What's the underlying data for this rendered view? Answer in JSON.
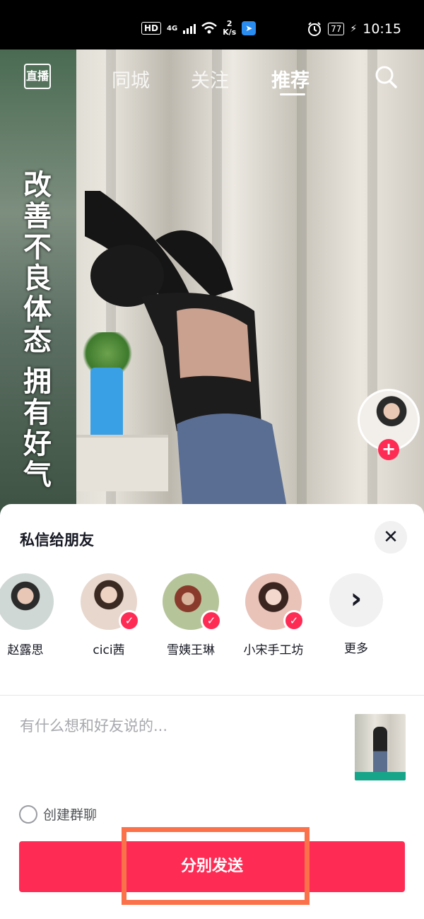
{
  "status_bar": {
    "hd_label": "HD",
    "network_label": "4G",
    "speed_value": "2",
    "speed_unit": "K/s",
    "battery": "77",
    "time": "10:15"
  },
  "top_nav": {
    "live_label": "直播",
    "tabs": [
      {
        "label": "同城",
        "active": false
      },
      {
        "label": "关注",
        "active": false
      },
      {
        "label": "推荐",
        "active": true
      }
    ]
  },
  "video": {
    "overlay_text": [
      "改",
      "善",
      "不",
      "良",
      "体",
      "态",
      "拥",
      "有",
      "好",
      "气"
    ]
  },
  "share_sheet": {
    "title": "私信给朋友",
    "friends": [
      {
        "name": "赵露思",
        "selected": false,
        "avatar_color": "#cfd8d4"
      },
      {
        "name": "cici茜",
        "selected": true,
        "avatar_color": "#e8d7cd"
      },
      {
        "name": "雪姨王琳",
        "selected": true,
        "avatar_color": "#b6c49a"
      },
      {
        "name": "小宋手工坊",
        "selected": true,
        "avatar_color": "#e9c2b8"
      }
    ],
    "more_label": "更多",
    "message_placeholder": "有什么想和好友说的...",
    "group_chat_label": "创建群聊",
    "send_label": "分别发送"
  },
  "colors": {
    "accent": "#fe2c55",
    "highlight_box": "#fb7149"
  }
}
